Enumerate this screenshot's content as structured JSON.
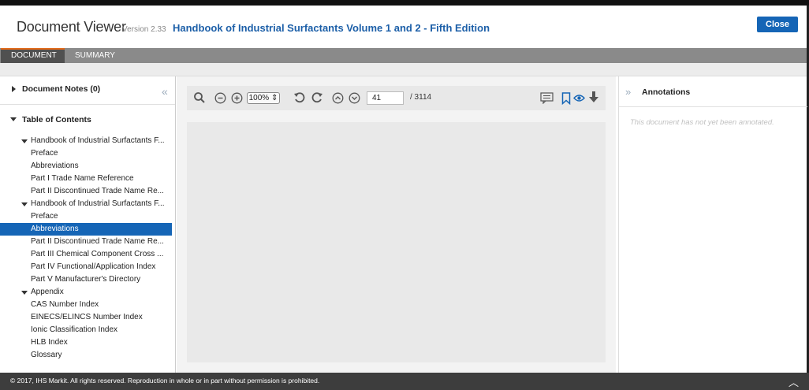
{
  "app": {
    "title": "Document Viewer",
    "version": "Version 2.33",
    "document_title": "Handbook of Industrial Surfactants Volume 1 and 2 - Fifth Edition",
    "close_label": "Close"
  },
  "tabs": [
    {
      "label": "DOCUMENT",
      "active": true
    },
    {
      "label": "SUMMARY",
      "active": false
    }
  ],
  "sidebar": {
    "notes_label": "Document Notes (0)",
    "toc_label": "Table of Contents",
    "toc": [
      {
        "label": "Handbook of Industrial Surfactants F...",
        "level": 1,
        "expanded": true
      },
      {
        "label": "Preface",
        "level": 2
      },
      {
        "label": "Abbreviations",
        "level": 2
      },
      {
        "label": "Part I Trade Name Reference",
        "level": 2
      },
      {
        "label": "Part II Discontinued Trade Name Re...",
        "level": 2
      },
      {
        "label": "Handbook of Industrial Surfactants F...",
        "level": 1,
        "expanded": true
      },
      {
        "label": "Preface",
        "level": 2
      },
      {
        "label": "Abbreviations",
        "level": 2,
        "selected": true
      },
      {
        "label": "Part II Discontinued Trade Name Re...",
        "level": 2
      },
      {
        "label": "Part III Chemical Component Cross ...",
        "level": 2
      },
      {
        "label": "Part IV Functional/Application Index",
        "level": 2
      },
      {
        "label": "Part V Manufacturer's Directory",
        "level": 2
      },
      {
        "label": "Appendix",
        "level": 1,
        "expanded": true
      },
      {
        "label": "CAS Number Index",
        "level": 2
      },
      {
        "label": "EINECS/ELINCS Number Index",
        "level": 2
      },
      {
        "label": "Ionic Classification Index",
        "level": 2
      },
      {
        "label": "HLB Index",
        "level": 2
      },
      {
        "label": "Glossary",
        "level": 2
      }
    ]
  },
  "viewer": {
    "zoom": "100%",
    "page_current": "41",
    "page_total": "/ 3114"
  },
  "annotations": {
    "title": "Annotations",
    "empty_text": "This document has not yet been annotated."
  },
  "footer": {
    "text": "© 2017, IHS Markit. All rights reserved. Reproduction in whole or in part without permission is prohibited."
  },
  "colors": {
    "accent": "#1565b6",
    "tab_active_border": "#e26a1a",
    "footer_bg": "#3d3d3d"
  }
}
